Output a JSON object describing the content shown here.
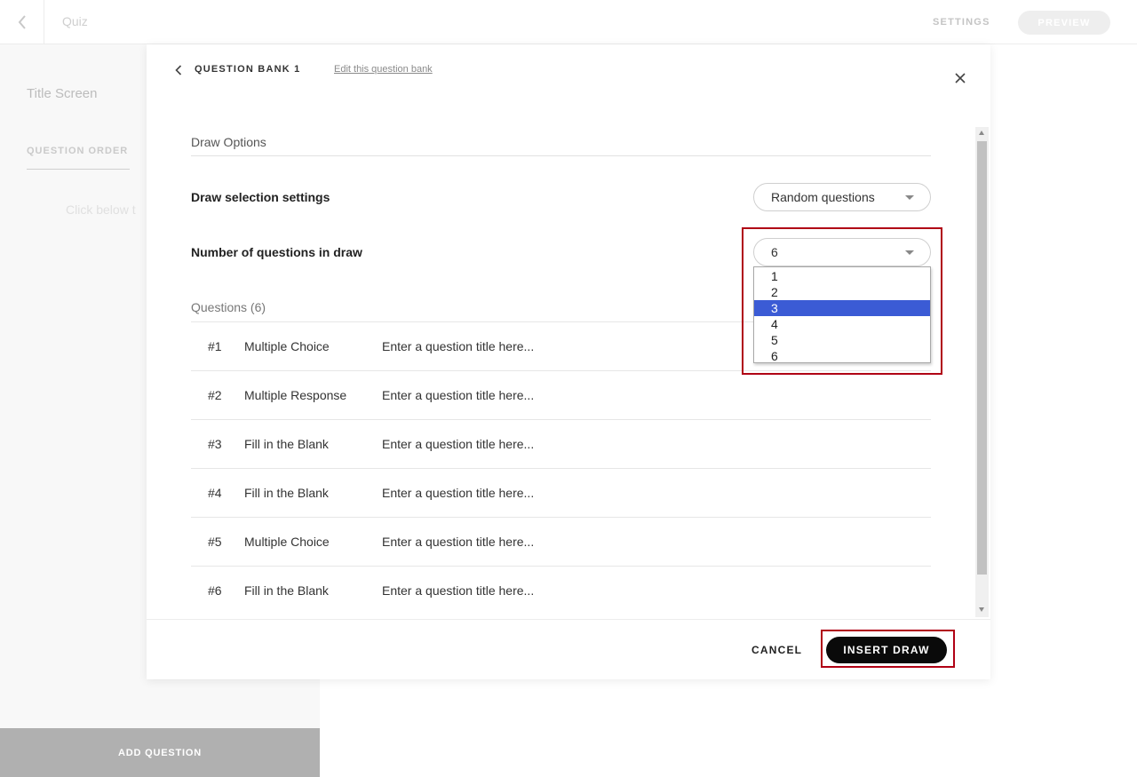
{
  "topbar": {
    "title": "Quiz",
    "settings_label": "SETTINGS",
    "preview_label": "PREVIEW"
  },
  "left_panel": {
    "title_screen": "Title Screen",
    "question_order_tab": "QUESTION ORDER",
    "hint": "Click below t",
    "add_question_label": "ADD QUESTION"
  },
  "modal": {
    "bank_name": "QUESTION BANK 1",
    "edit_link": "Edit this question bank",
    "draw_options_heading": "Draw Options",
    "draw_selection_label": "Draw selection settings",
    "draw_selection_value": "Random questions",
    "number_label": "Number of questions in draw",
    "number_value": "6",
    "number_options": [
      "1",
      "2",
      "3",
      "4",
      "5",
      "6"
    ],
    "number_highlighted": "3",
    "questions_header": "Questions (6)",
    "questions": [
      {
        "num": "#1",
        "type": "Multiple Choice",
        "title": "Enter a question title here..."
      },
      {
        "num": "#2",
        "type": "Multiple Response",
        "title": "Enter a question title here..."
      },
      {
        "num": "#3",
        "type": "Fill in the Blank",
        "title": "Enter a question title here..."
      },
      {
        "num": "#4",
        "type": "Fill in the Blank",
        "title": "Enter a question title here..."
      },
      {
        "num": "#5",
        "type": "Multiple Choice",
        "title": "Enter a question title here..."
      },
      {
        "num": "#6",
        "type": "Fill in the Blank",
        "title": "Enter a question title here..."
      }
    ],
    "cancel_label": "CANCEL",
    "insert_label": "INSERT DRAW"
  },
  "colors": {
    "highlight_border": "#b00014",
    "selected_option": "#3b5bd5",
    "primary_button": "#0a0a0a"
  }
}
